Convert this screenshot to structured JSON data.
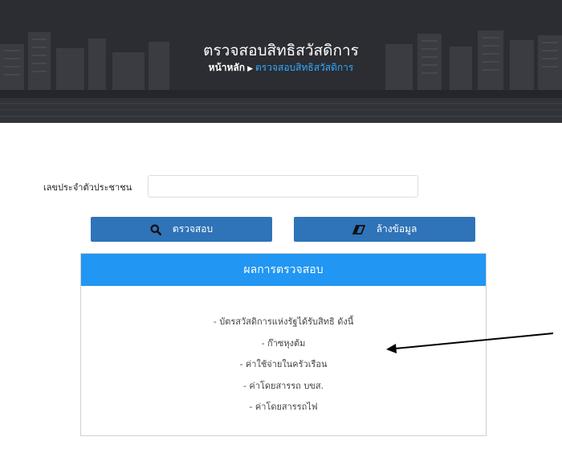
{
  "header": {
    "title": "ตรวจสอบสิทธิสวัสดิการ",
    "breadcrumb": {
      "home": "หน้าหลัก",
      "separator": "▶",
      "current": "ตรวจสอบสิทธิสวัสดิการ"
    }
  },
  "form": {
    "id_label": "เลขประจำตัวประชาชน",
    "id_value": "",
    "check_button": {
      "label": "ตรวจสอบ",
      "icon": "search-icon"
    },
    "clear_button": {
      "label": "ล้างข้อมูล",
      "icon": "eraser-icon"
    }
  },
  "result": {
    "title": "ผลการตรวจสอบ",
    "lines": [
      "- บัตรสวัสดิการแห่งรัฐได้รับสิทธิ ดังนี้",
      "- ก๊าซหุงต้ม",
      "- ค่าใช้จ่ายในครัวเรือน",
      "- ค่าโดยสารรถ บขส.",
      "- ค่าโดยสารรถไฟ"
    ]
  },
  "colors": {
    "button": "#2f73b8",
    "result_header": "#2196f3",
    "breadcrumb_link": "#33aaff"
  }
}
